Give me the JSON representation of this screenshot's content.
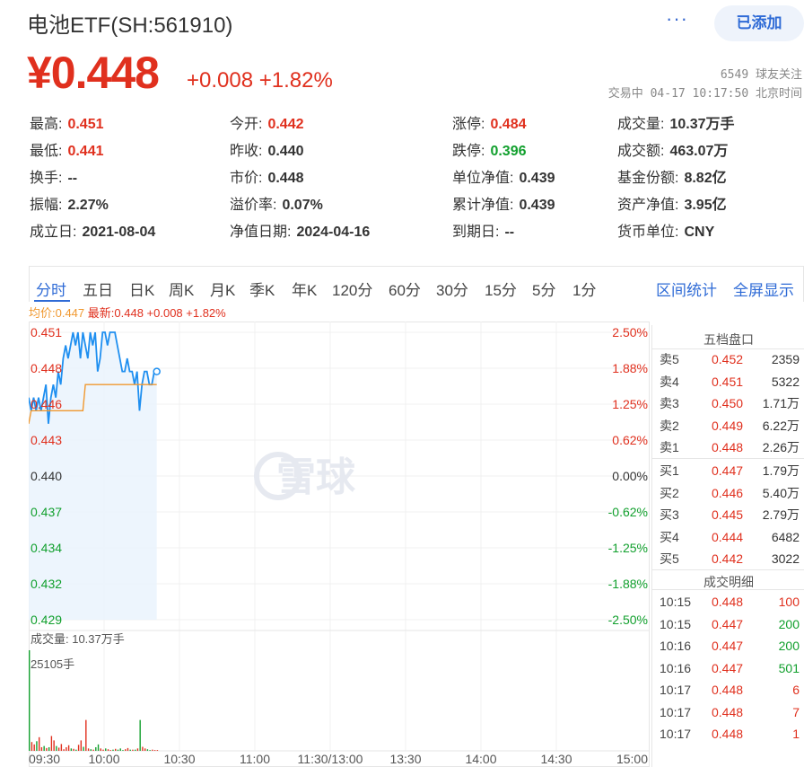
{
  "header": {
    "title": "电池ETF(SH:561910)",
    "more": "···",
    "added_button": "已添加"
  },
  "quote": {
    "price": "¥0.448",
    "change": "+0.008",
    "change_pct": "+1.82%",
    "followers": "6549 球友关注",
    "trade_time": "交易中 04-17 10:17:50 北京时间"
  },
  "stats": [
    {
      "label": "最高:",
      "value": "0.451",
      "color": "red"
    },
    {
      "label": "今开:",
      "value": "0.442",
      "color": "red"
    },
    {
      "label": "涨停:",
      "value": "0.484",
      "color": "red"
    },
    {
      "label": "成交量:",
      "value": "10.37万手",
      "color": ""
    },
    {
      "label": "最低:",
      "value": "0.441",
      "color": "red"
    },
    {
      "label": "昨收:",
      "value": "0.440",
      "color": ""
    },
    {
      "label": "跌停:",
      "value": "0.396",
      "color": "green"
    },
    {
      "label": "成交额:",
      "value": "463.07万",
      "color": ""
    },
    {
      "label": "换手:",
      "value": "--",
      "color": ""
    },
    {
      "label": "市价:",
      "value": "0.448",
      "color": ""
    },
    {
      "label": "单位净值:",
      "value": "0.439",
      "color": ""
    },
    {
      "label": "基金份额:",
      "value": "8.82亿",
      "color": ""
    },
    {
      "label": "振幅:",
      "value": "2.27%",
      "color": ""
    },
    {
      "label": "溢价率:",
      "value": "0.07%",
      "color": ""
    },
    {
      "label": "累计净值:",
      "value": "0.439",
      "color": ""
    },
    {
      "label": "资产净值:",
      "value": "3.95亿",
      "color": ""
    },
    {
      "label": "成立日:",
      "value": "2021-08-04",
      "color": ""
    },
    {
      "label": "净值日期:",
      "value": "2024-04-16",
      "color": ""
    },
    {
      "label": "到期日:",
      "value": "--",
      "color": ""
    },
    {
      "label": "货币单位:",
      "value": "CNY",
      "color": ""
    }
  ],
  "tabs": [
    "分时",
    "五日",
    "日K",
    "周K",
    "月K",
    "季K",
    "年K",
    "120分",
    "60分",
    "30分",
    "15分",
    "5分",
    "1分"
  ],
  "active_tab": "分时",
  "tools": {
    "range_stats": "区间统计",
    "fullscreen": "全屏显示"
  },
  "legend": {
    "avg": "均价:0.447",
    "latest": "最新:0.448 +0.008 +1.82%"
  },
  "order_book": {
    "title": "五档盘口",
    "asks": [
      {
        "label": "卖5",
        "price": "0.452",
        "vol": "2359"
      },
      {
        "label": "卖4",
        "price": "0.451",
        "vol": "5322"
      },
      {
        "label": "卖3",
        "price": "0.450",
        "vol": "1.71万"
      },
      {
        "label": "卖2",
        "price": "0.449",
        "vol": "6.22万"
      },
      {
        "label": "卖1",
        "price": "0.448",
        "vol": "2.26万"
      }
    ],
    "bids": [
      {
        "label": "买1",
        "price": "0.447",
        "vol": "1.79万"
      },
      {
        "label": "买2",
        "price": "0.446",
        "vol": "5.40万"
      },
      {
        "label": "买3",
        "price": "0.445",
        "vol": "2.79万"
      },
      {
        "label": "买4",
        "price": "0.444",
        "vol": "6482"
      },
      {
        "label": "买5",
        "price": "0.442",
        "vol": "3022"
      }
    ],
    "trades_title": "成交明细",
    "trades": [
      {
        "time": "10:15",
        "price": "0.448",
        "vol": "100",
        "color": "red"
      },
      {
        "time": "10:15",
        "price": "0.447",
        "vol": "200",
        "color": "green"
      },
      {
        "time": "10:16",
        "price": "0.447",
        "vol": "200",
        "color": "green"
      },
      {
        "time": "10:16",
        "price": "0.447",
        "vol": "501",
        "color": "green"
      },
      {
        "time": "10:17",
        "price": "0.448",
        "vol": "6",
        "color": "red"
      },
      {
        "time": "10:17",
        "price": "0.448",
        "vol": "7",
        "color": "red"
      },
      {
        "time": "10:17",
        "price": "0.448",
        "vol": "1",
        "color": "red"
      }
    ]
  },
  "chart_data": {
    "type": "line",
    "watermark": "雪球",
    "y_ticks_left": [
      "0.451",
      "0.448",
      "0.446",
      "0.443",
      "0.440",
      "0.437",
      "0.434",
      "0.432",
      "0.429"
    ],
    "y_ticks_right": [
      "2.50%",
      "1.88%",
      "1.25%",
      "0.62%",
      "0.00%",
      "-0.62%",
      "-1.25%",
      "-1.88%",
      "-2.50%"
    ],
    "ylim": [
      0.429,
      0.451
    ],
    "x_ticks": [
      "09:30",
      "10:00",
      "10:30",
      "11:00",
      "11:30/13:00",
      "13:30",
      "14:00",
      "14:30",
      "15:00"
    ],
    "volume_label": "成交量: 10.37万手",
    "volume_max_label": "25105手",
    "price_series": {
      "name": "最新",
      "values": [
        0.446,
        0.445,
        0.446,
        0.445,
        0.446,
        0.445,
        0.446,
        0.447,
        0.444,
        0.446,
        0.447,
        0.446,
        0.448,
        0.447,
        0.449,
        0.45,
        0.449,
        0.45,
        0.451,
        0.45,
        0.451,
        0.449,
        0.451,
        0.45,
        0.449,
        0.451,
        0.45,
        0.451,
        0.448,
        0.449,
        0.451,
        0.451,
        0.45,
        0.451,
        0.451,
        0.451,
        0.45,
        0.449,
        0.448,
        0.448,
        0.449,
        0.448,
        0.448,
        0.447,
        0.448,
        0.445,
        0.447,
        0.448,
        0.448,
        0.447,
        0.447,
        0.448,
        0.448
      ]
    },
    "avg_series": {
      "name": "均价",
      "values": [
        0.444,
        0.445,
        0.445,
        0.445,
        0.445,
        0.445,
        0.445,
        0.445,
        0.445,
        0.445,
        0.445,
        0.445,
        0.445,
        0.445,
        0.445,
        0.445,
        0.445,
        0.445,
        0.445,
        0.445,
        0.445,
        0.445,
        0.445,
        0.447,
        0.447,
        0.447,
        0.447,
        0.447,
        0.447,
        0.447,
        0.447,
        0.447,
        0.447,
        0.447,
        0.447,
        0.447,
        0.447,
        0.447,
        0.447,
        0.447,
        0.447,
        0.447,
        0.447,
        0.447,
        0.447,
        0.447,
        0.447,
        0.447,
        0.447,
        0.447,
        0.447,
        0.447,
        0.447
      ]
    },
    "volume_series": {
      "name": "成交量",
      "values": [
        25105,
        2200,
        1600,
        2400,
        3400,
        900,
        1200,
        700,
        900,
        3700,
        2600,
        1200,
        800,
        1700,
        400,
        900,
        1400,
        600,
        500,
        300,
        1500,
        2600,
        1000,
        7700,
        600,
        400,
        300,
        900,
        1600,
        600,
        300,
        600,
        400,
        200,
        300,
        500,
        300,
        600,
        200,
        400,
        700,
        300,
        300,
        300,
        600,
        7700,
        1000,
        600,
        400,
        200,
        300,
        200,
        200
      ],
      "colors": [
        "green",
        "red",
        "red",
        "green",
        "red",
        "red",
        "green",
        "red",
        "green",
        "red",
        "red",
        "green",
        "red",
        "red",
        "red",
        "red",
        "red",
        "green",
        "red",
        "green",
        "red",
        "red",
        "green",
        "red",
        "red",
        "green",
        "red",
        "green",
        "green",
        "red",
        "red",
        "green",
        "red",
        "red",
        "green",
        "red",
        "green",
        "green",
        "green",
        "red",
        "red",
        "green",
        "red",
        "green",
        "red",
        "green",
        "red",
        "red",
        "green",
        "green",
        "red",
        "red",
        "red"
      ]
    }
  },
  "colors": {
    "up": "#e0301e",
    "down": "#12a02e",
    "accent": "#2f6bd6",
    "avg_line": "#f0982f",
    "price_line": "#1f8ff0"
  }
}
